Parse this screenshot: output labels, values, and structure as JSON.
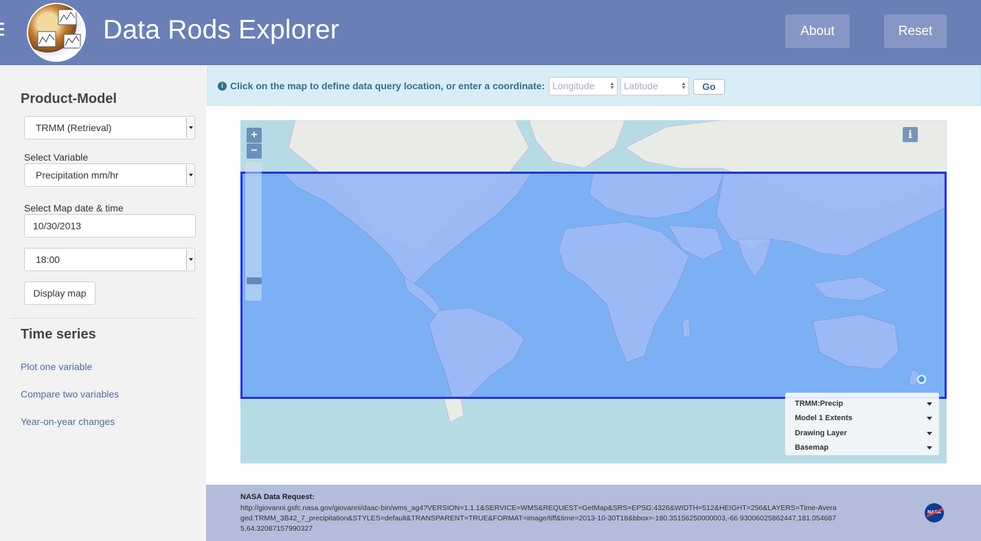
{
  "header": {
    "title": "Data Rods Explorer",
    "about_label": "About",
    "reset_label": "Reset"
  },
  "sidebar": {
    "product_model_title": "Product-Model",
    "product_model_value": "TRMM (Retrieval)",
    "variable_label": "Select Variable",
    "variable_value": "Precipitation mm/hr",
    "date_label": "Select Map date & time",
    "date_value": "10/30/2013",
    "time_value": "18:00",
    "display_map_label": "Display map",
    "time_series_title": "Time series",
    "links": [
      "Plot one variable",
      "Compare two variables",
      "Year-on-year changes"
    ]
  },
  "infobar": {
    "icon": "info-icon",
    "message": "Click on the map to define data query location, or enter a coordinate:",
    "longitude_placeholder": "Longitude",
    "latitude_placeholder": "Latitude",
    "go_label": "Go"
  },
  "map": {
    "zoom_in": "+",
    "zoom_out": "−",
    "info_button": "i",
    "layers": [
      "TRMM:Precip",
      "Model 1 Extents",
      "Drawing Layer",
      "Basemap"
    ]
  },
  "footer": {
    "request_title": "NASA Data Request:",
    "request_url": "http://giovanni.gsfc.nasa.gov/giovanni/daac-bin/wms_ag4?VERSION=1.1.1&SERVICE=WMS&REQUEST=GetMap&SRS=EPSG:4326&WIDTH=512&HEIGHT=256&LAYERS=Time-Averaged.TRMM_3B42_7_precipitation&STYLES=default&TRANSPARENT=TRUE&FORMAT=image/tiff&time=2013-10-30T18&bbox=-180.35156250000003,-66.93006025862447,181.0546875,64.32087157990327",
    "nasa_logo": "NASA"
  },
  "colors": {
    "header_bg": "#6a7fb5",
    "info_bg": "#d9edf7",
    "query_rect": "#2030e8",
    "link": "#4d6ca8"
  }
}
